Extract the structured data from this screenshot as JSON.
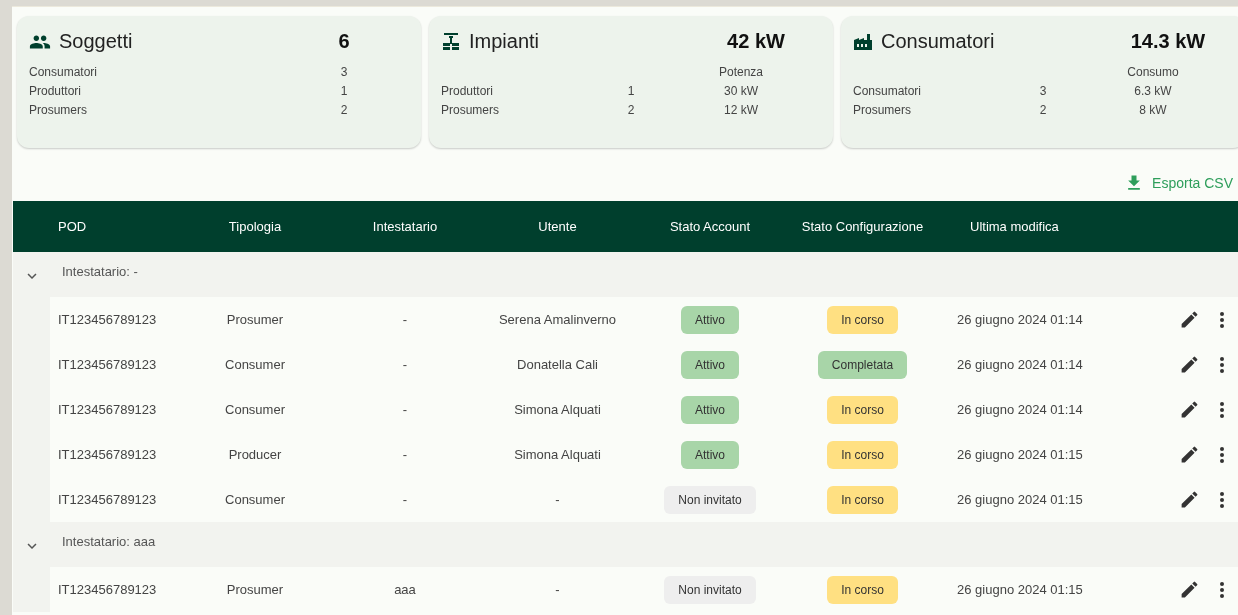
{
  "summary_cards": [
    {
      "kind": "people",
      "title": "Soggetti",
      "total": "6",
      "rows": [
        {
          "label": "Consumatori",
          "count": "3"
        },
        {
          "label": "Produttori",
          "count": "1"
        },
        {
          "label": "Prosumers",
          "count": "2"
        }
      ]
    },
    {
      "kind": "plant",
      "title": "Impianti",
      "total": "42 kW",
      "value_header": "Potenza",
      "rows": [
        {
          "label": "Produttori",
          "count": "1",
          "value": "30 kW"
        },
        {
          "label": "Prosumers",
          "count": "2",
          "value": "12 kW"
        }
      ]
    },
    {
      "kind": "factory",
      "title": "Consumatori",
      "total": "14.3 kW",
      "value_header": "Consumo",
      "rows": [
        {
          "label": "Consumatori",
          "count": "3",
          "value": "6.3 kW"
        },
        {
          "label": "Prosumers",
          "count": "2",
          "value": "8 kW"
        }
      ]
    }
  ],
  "export_button": "Esporta CSV",
  "table": {
    "columns": [
      "POD",
      "Tipologia",
      "Intestatario",
      "Utente",
      "Stato Account",
      "Stato Configurazione",
      "Ultima modifica"
    ],
    "groups": [
      {
        "label": "Intestatario: -",
        "expanded": true,
        "rows": [
          {
            "pod": "IT123456789123",
            "type": "Prosumer",
            "holder": "-",
            "user": "Serena Amalinverno",
            "account": {
              "label": "Attivo",
              "color": "#a8d5a8"
            },
            "config": {
              "label": "In corso",
              "color": "#ffe082"
            },
            "modified": "26 giugno 2024 01:14"
          },
          {
            "pod": "IT123456789123",
            "type": "Consumer",
            "holder": "-",
            "user": "Donatella Cali",
            "account": {
              "label": "Attivo",
              "color": "#a8d5a8"
            },
            "config": {
              "label": "Completata",
              "color": "#a8d5a8"
            },
            "modified": "26 giugno 2024 01:14"
          },
          {
            "pod": "IT123456789123",
            "type": "Consumer",
            "holder": "-",
            "user": "Simona Alquati",
            "account": {
              "label": "Attivo",
              "color": "#a8d5a8"
            },
            "config": {
              "label": "In corso",
              "color": "#ffe082"
            },
            "modified": "26 giugno 2024 01:14"
          },
          {
            "pod": "IT123456789123",
            "type": "Producer",
            "holder": "-",
            "user": "Simona Alquati",
            "account": {
              "label": "Attivo",
              "color": "#a8d5a8"
            },
            "config": {
              "label": "In corso",
              "color": "#ffe082"
            },
            "modified": "26 giugno 2024 01:15"
          },
          {
            "pod": "IT123456789123",
            "type": "Consumer",
            "holder": "-",
            "user": "-",
            "account": {
              "label": "Non invitato",
              "color": "#eeeeee"
            },
            "config": {
              "label": "In corso",
              "color": "#ffe082"
            },
            "modified": "26 giugno 2024 01:15"
          }
        ]
      },
      {
        "label": "Intestatario: aaa",
        "expanded": true,
        "rows": [
          {
            "pod": "IT123456789123",
            "type": "Prosumer",
            "holder": "aaa",
            "user": "-",
            "account": {
              "label": "Non invitato",
              "color": "#eeeeee"
            },
            "config": {
              "label": "In corso",
              "color": "#ffe082"
            },
            "modified": "26 giugno 2024 01:15"
          }
        ]
      }
    ]
  }
}
